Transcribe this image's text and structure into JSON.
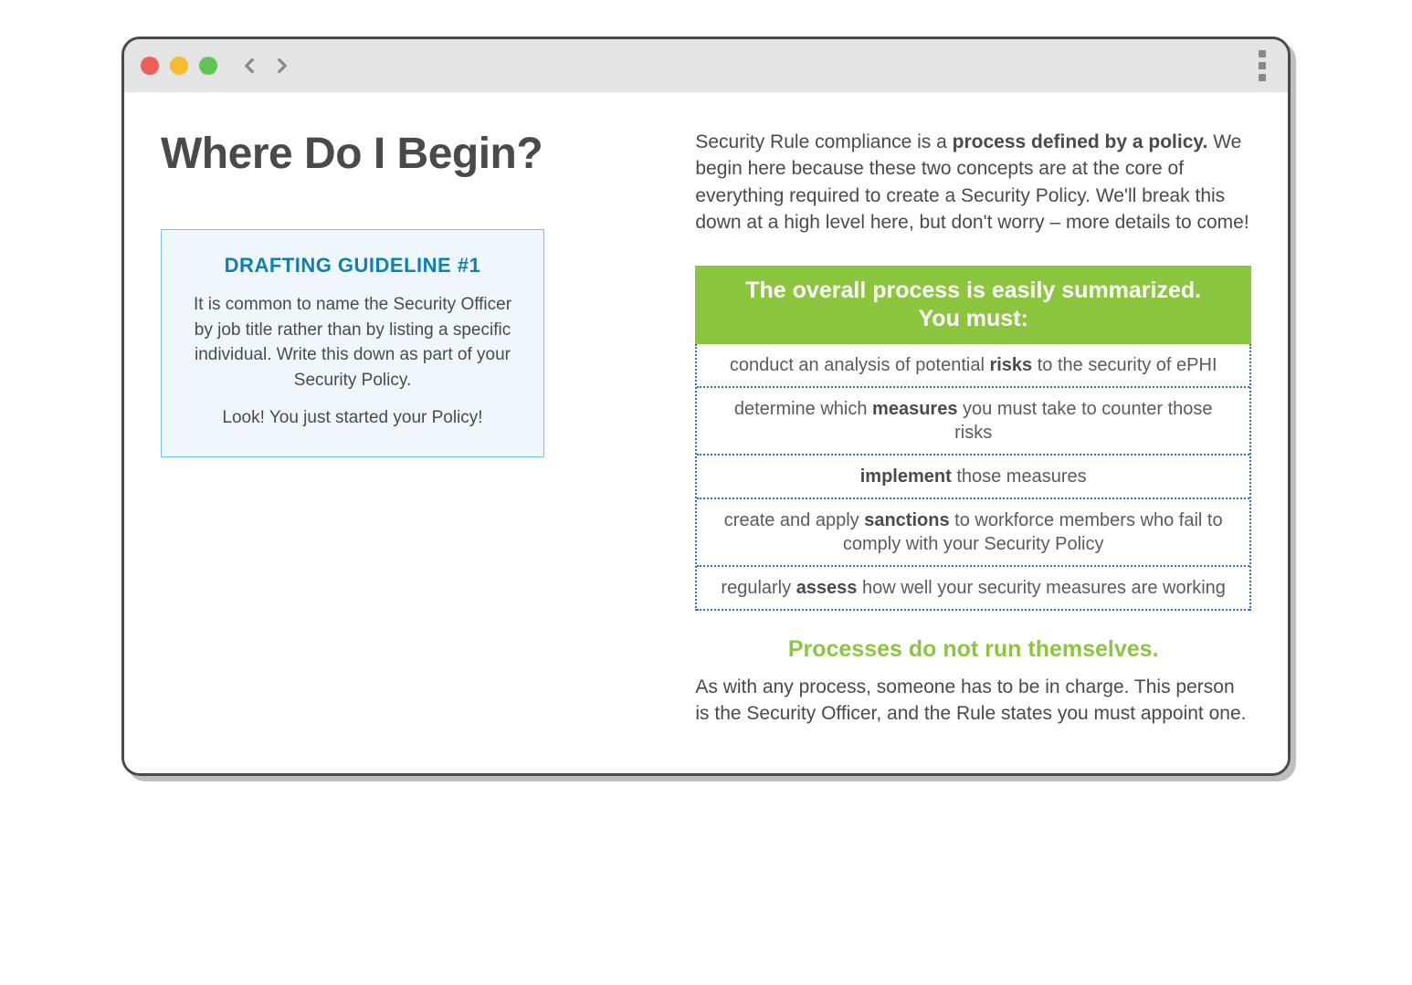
{
  "page": {
    "title": "Where Do I Begin?"
  },
  "callout": {
    "title": "DRAFTING GUIDELINE #1",
    "para1": "It is common to name the Security Officer by job title rather than by listing a specific individual. Write this down as part of your Security Policy.",
    "para2": "Look! You just started your Policy!"
  },
  "intro": {
    "lead": "Security Rule compliance is a ",
    "bold": "process defined by a policy.",
    "rest": " We begin here because these two concepts are at the core of everything required to create a Security Policy. We'll break this down at a high level here, but don't worry – more details to come!"
  },
  "process": {
    "header_line1": "The overall process is easily summarized.",
    "header_line2": "You must:",
    "items": [
      {
        "pre": "conduct an analysis of potential ",
        "bold": "risks",
        "post": " to the security of ePHI"
      },
      {
        "pre": "determine which ",
        "bold": "measures",
        "post": " you must take to counter those risks"
      },
      {
        "pre": "",
        "bold": "implement",
        "post": " those measures"
      },
      {
        "pre": "create and apply ",
        "bold": "sanctions",
        "post": " to workforce members who fail to comply with your Security Policy"
      },
      {
        "pre": "regularly ",
        "bold": "assess",
        "post": " how well your security measures are working"
      }
    ]
  },
  "subhead": "Processes do not run themselves.",
  "closing": "As with any process, someone has to be in charge. This person is the Security Officer, and the Rule states you must appoint one.",
  "colors": {
    "accent_green": "#8cc63f",
    "accent_blue": "#0f7fb6",
    "callout_border": "#77c3e5",
    "callout_bg": "#eef8fc",
    "dotted_border": "#2f77b2",
    "text": "#4a4a4a"
  }
}
